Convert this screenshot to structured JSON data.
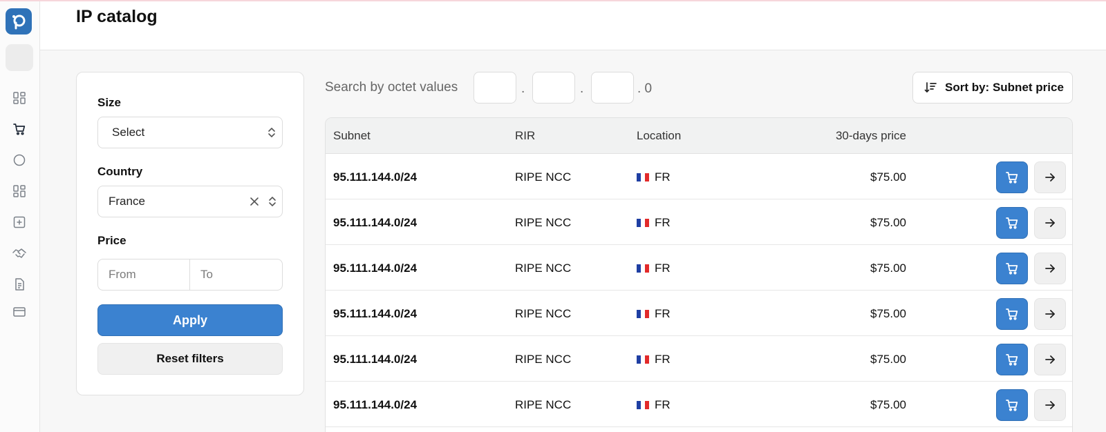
{
  "header": {
    "title": "IP catalog"
  },
  "sidebar": {
    "logo_icon": "search-logo-icon",
    "items": [
      {
        "icon": "dashboard-grid-icon"
      },
      {
        "icon": "cart-icon"
      },
      {
        "icon": "circle-icon"
      },
      {
        "icon": "grid-icon"
      },
      {
        "icon": "plus-square-icon"
      },
      {
        "icon": "handshake-icon"
      },
      {
        "icon": "document-icon"
      },
      {
        "icon": "credit-card-icon"
      }
    ]
  },
  "filters": {
    "size": {
      "label": "Size",
      "value": "Select"
    },
    "country": {
      "label": "Country",
      "value": "France"
    },
    "price": {
      "label": "Price",
      "from_placeholder": "From",
      "to_placeholder": "To"
    },
    "apply_label": "Apply",
    "reset_label": "Reset filters"
  },
  "search": {
    "label": "Search by octet values",
    "dot1": ".",
    "dot2": ".",
    "suffix": ". 0"
  },
  "sort": {
    "label": "Sort by: Subnet price"
  },
  "table": {
    "columns": {
      "subnet": "Subnet",
      "rir": "RIR",
      "location": "Location",
      "price": "30-days price"
    },
    "rows": [
      {
        "subnet": "95.111.144.0/24",
        "rir": "RIPE NCC",
        "location": "FR",
        "price": "$75.00"
      },
      {
        "subnet": "95.111.144.0/24",
        "rir": "RIPE NCC",
        "location": "FR",
        "price": "$75.00"
      },
      {
        "subnet": "95.111.144.0/24",
        "rir": "RIPE NCC",
        "location": "FR",
        "price": "$75.00"
      },
      {
        "subnet": "95.111.144.0/24",
        "rir": "RIPE NCC",
        "location": "FR",
        "price": "$75.00"
      },
      {
        "subnet": "95.111.144.0/24",
        "rir": "RIPE NCC",
        "location": "FR",
        "price": "$75.00"
      },
      {
        "subnet": "95.111.144.0/24",
        "rir": "RIPE NCC",
        "location": "FR",
        "price": "$75.00"
      }
    ]
  },
  "colors": {
    "accent": "#3b82d0",
    "flag_blue": "#1f3fa3",
    "flag_red": "#e22a2a"
  }
}
